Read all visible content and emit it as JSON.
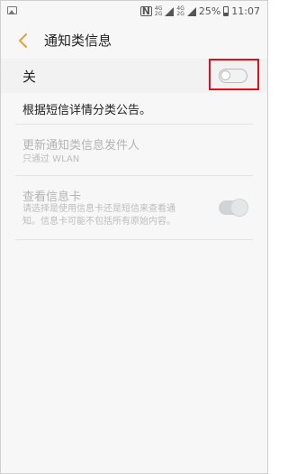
{
  "status_bar": {
    "nfc": "N",
    "net_top": "4G",
    "net_bottom": "2G",
    "net_top_2": "4G",
    "net_bottom_2": "2G",
    "battery": "25%",
    "time": "11:07"
  },
  "header": {
    "title": "通知类信息"
  },
  "main_toggle": {
    "label": "关",
    "state": "off"
  },
  "description": "根据短信详情分类公告。",
  "items": [
    {
      "title": "更新通知类信息发件人",
      "subtitle": "只通过 WLAN"
    },
    {
      "title": "查看信息卡",
      "subtitle_line1": "请选择是使用信息卡还是短信来查看通",
      "subtitle_line2": "知。信息卡可能不包括所有原始内容。"
    }
  ],
  "colors": {
    "accent_back": "#e6a23c",
    "highlight": "#e0101a",
    "disabled_text": "#b4b4b4"
  }
}
